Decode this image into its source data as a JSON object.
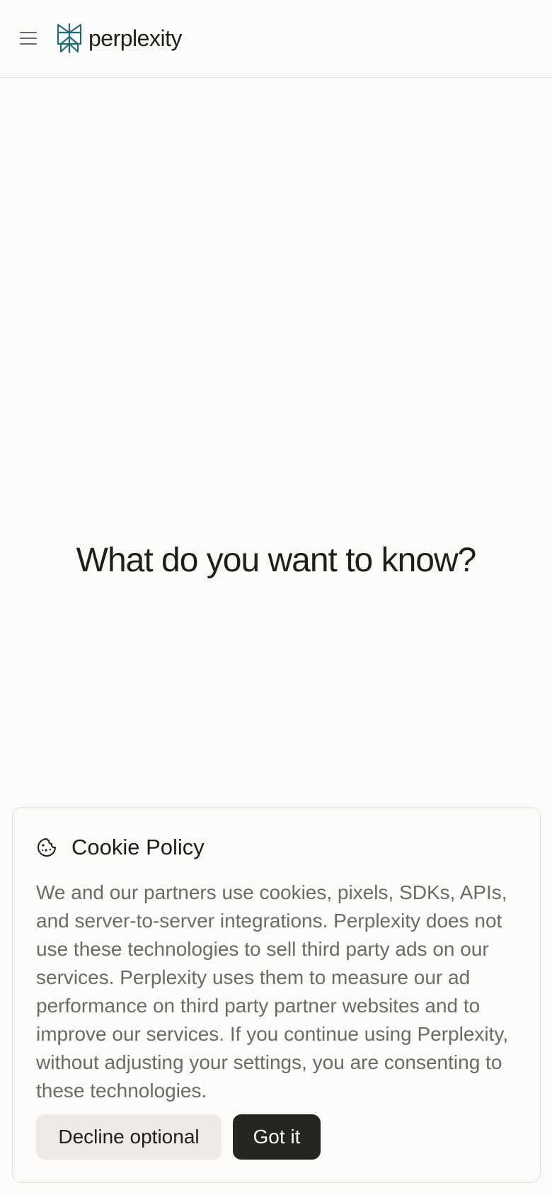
{
  "header": {
    "menu_icon": "hamburger-menu-icon",
    "logo_icon": "perplexity-logo-icon",
    "logo_text": "perplexity",
    "brand_color": "#1f6d72"
  },
  "main": {
    "heading": "What do you want to know?"
  },
  "cookie_banner": {
    "icon": "cookie-icon",
    "title": "Cookie Policy",
    "body": "We and our partners use cookies, pixels, SDKs, APIs, and server-to-server integrations. Perplexity does not use these technologies to sell third party ads on our services. Perplexity uses them to measure our ad performance on third party partner websites and to improve our services. If you continue using Perplexity, without adjusting your settings, you are consenting to these technologies.",
    "decline_label": "Decline optional",
    "accept_label": "Got it"
  },
  "colors": {
    "background": "#fcfbf9",
    "text": "#1f1e1b",
    "muted_text": "#6b6a66",
    "secondary_button": "#eeebe7",
    "primary_button": "#272520"
  }
}
